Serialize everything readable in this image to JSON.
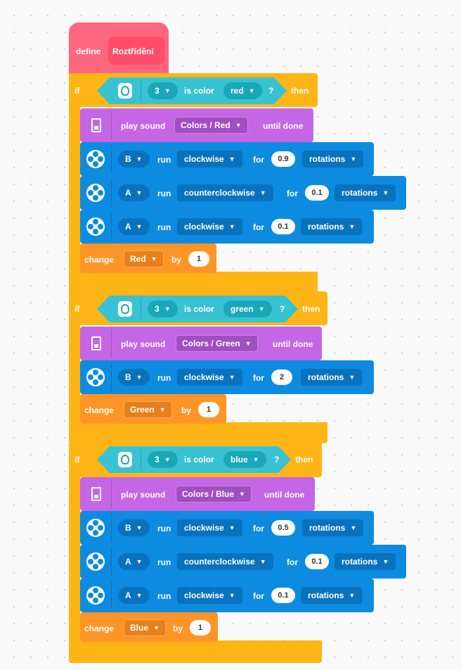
{
  "define": {
    "keyword": "define",
    "name": "Roztřídění"
  },
  "groups": [
    {
      "if_label": "if",
      "then_label": "then",
      "port": "3",
      "is_color": "is color",
      "color": "red",
      "question": "?",
      "sound": {
        "play": "play sound",
        "value": "Colors / Red",
        "until": "until done"
      },
      "motors": [
        {
          "port": "B",
          "run": "run",
          "dir": "clockwise",
          "for": "for",
          "amount": "0.9",
          "unit": "rotations"
        },
        {
          "port": "A",
          "run": "run",
          "dir": "counterclockwise",
          "for": "for",
          "amount": "0.1",
          "unit": "rotations"
        },
        {
          "port": "A",
          "run": "run",
          "dir": "clockwise",
          "for": "for",
          "amount": "0.1",
          "unit": "rotations"
        }
      ],
      "change": {
        "label": "change",
        "variable": "Red",
        "by": "by",
        "value": "1"
      }
    },
    {
      "if_label": "if",
      "then_label": "then",
      "port": "3",
      "is_color": "is color",
      "color": "green",
      "question": "?",
      "sound": {
        "play": "play sound",
        "value": "Colors / Green",
        "until": "until done"
      },
      "motors": [
        {
          "port": "B",
          "run": "run",
          "dir": "clockwise",
          "for": "for",
          "amount": "2",
          "unit": "rotations"
        }
      ],
      "change": {
        "label": "change",
        "variable": "Green",
        "by": "by",
        "value": "1"
      }
    },
    {
      "if_label": "if",
      "then_label": "then",
      "port": "3",
      "is_color": "is color",
      "color": "blue",
      "question": "?",
      "sound": {
        "play": "play sound",
        "value": "Colors / Blue",
        "until": "until done"
      },
      "motors": [
        {
          "port": "B",
          "run": "run",
          "dir": "clockwise",
          "for": "for",
          "amount": "0.5",
          "unit": "rotations"
        },
        {
          "port": "A",
          "run": "run",
          "dir": "counterclockwise",
          "for": "for",
          "amount": "0.1",
          "unit": "rotations"
        },
        {
          "port": "A",
          "run": "run",
          "dir": "clockwise",
          "for": "for",
          "amount": "0.1",
          "unit": "rotations"
        }
      ],
      "change": {
        "label": "change",
        "variable": "Blue",
        "by": "by",
        "value": "1"
      }
    }
  ],
  "colors": {
    "define": "#ff6680",
    "define_arg": "#ff4d6a",
    "control": "#ffb515",
    "sensor": "#38c2d2",
    "sensor_dark": "#1aa8b8",
    "sound": "#c466e6",
    "sound_dark": "#a14ec2",
    "motor": "#0d8be0",
    "motor_dark": "#0a72bd",
    "variable": "#ff9526",
    "variable_dark": "#e7801b"
  }
}
